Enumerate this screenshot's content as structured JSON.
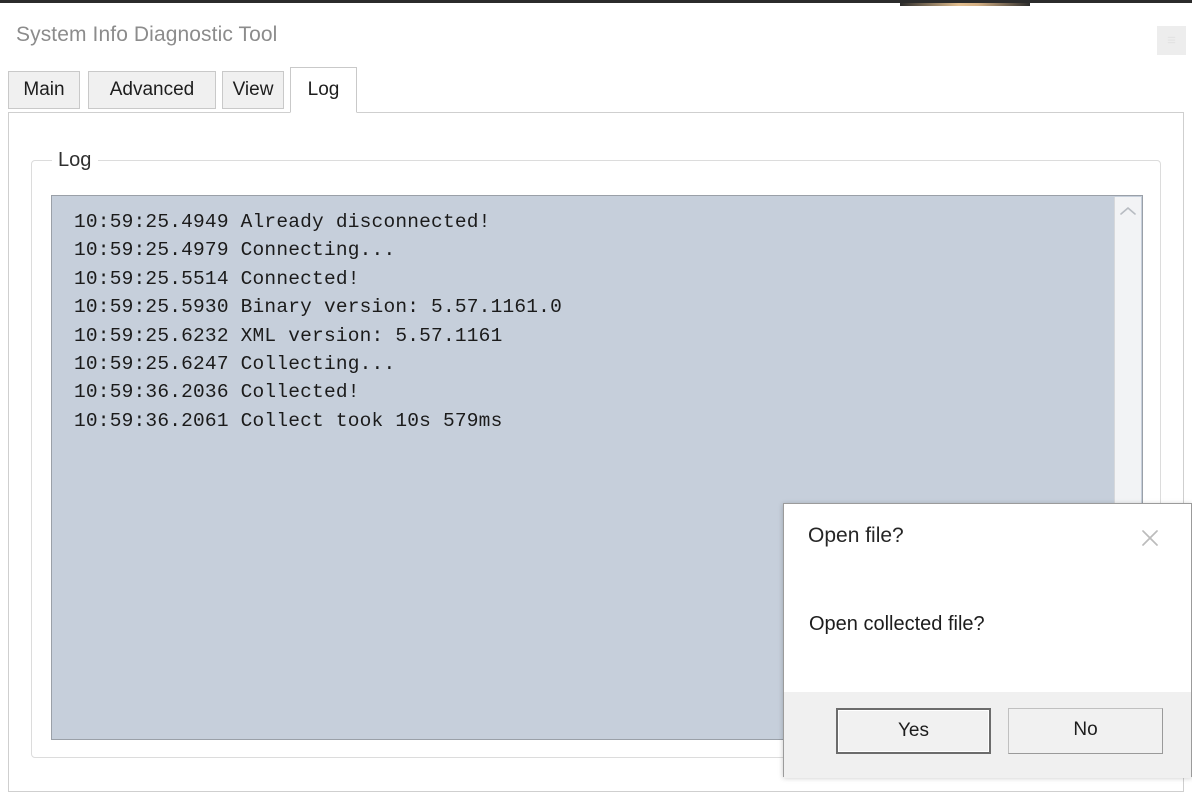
{
  "window": {
    "title": "System Info Diagnostic Tool",
    "menu_button_icon": "menu-icon",
    "menu_button_glyph": "≡"
  },
  "tabs": [
    {
      "id": "main",
      "label": "Main",
      "active": false
    },
    {
      "id": "advanced",
      "label": "Advanced",
      "active": false
    },
    {
      "id": "view",
      "label": "View",
      "active": false
    },
    {
      "id": "log",
      "label": "Log",
      "active": true
    }
  ],
  "log_panel": {
    "groupbox_label": "Log",
    "background_color": "#c6cfdb",
    "scrollbar": {
      "up_arrow_icon": "chevron-up-icon"
    },
    "lines": [
      "10:59:25.4949 Already disconnected!",
      "10:59:25.4979 Connecting...",
      "10:59:25.5514 Connected!",
      "10:59:25.5930 Binary version: 5.57.1161.0",
      "10:59:25.6232 XML version: 5.57.1161",
      "10:59:25.6247 Collecting...",
      "10:59:36.2036 Collected!",
      "10:59:36.2061 Collect took 10s 579ms"
    ]
  },
  "dialog": {
    "title": "Open file?",
    "close_icon": "close-icon",
    "message": "Open collected file?",
    "buttons": {
      "yes_label": "Yes",
      "no_label": "No"
    }
  }
}
